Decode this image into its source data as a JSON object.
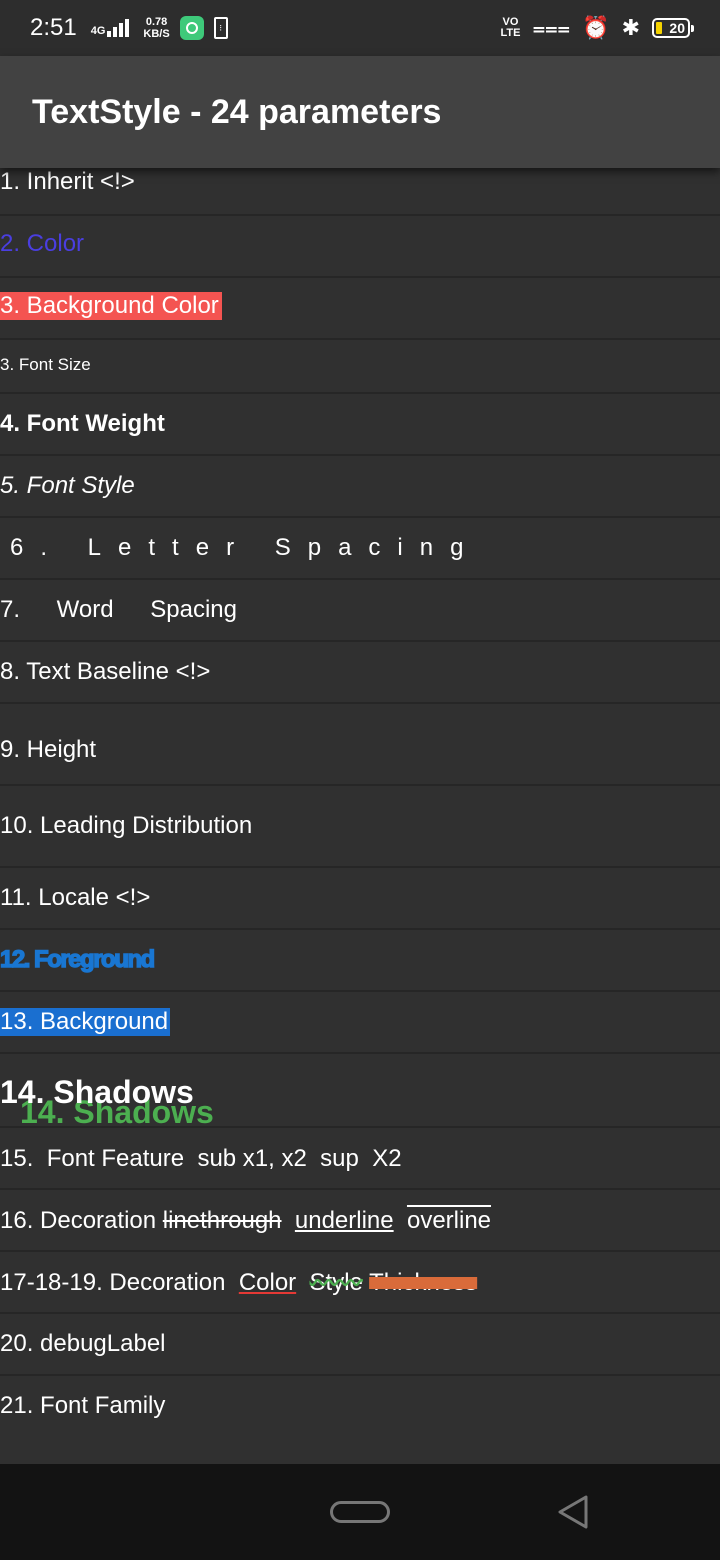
{
  "status_bar": {
    "time": "2:51",
    "network": "4G",
    "speed_value": "0.78",
    "speed_unit": "KB/S",
    "volte_top": "VO",
    "volte_bottom": "LTE",
    "battery": "20",
    "icons": [
      "app-badge-icon",
      "sim-icon",
      "vibrate-icon",
      "alarm-icon",
      "bluetooth-icon",
      "battery-icon"
    ]
  },
  "app_bar": {
    "title": "TextStyle - 24 parameters"
  },
  "items": [
    "1. Inherit <!>",
    "2. Color",
    "3. Background Color",
    "3. Font Size",
    "4. Font Weight",
    "5. Font Style",
    "6. Letter Spacing",
    "7. Word Spacing",
    "8. Text Baseline <!>",
    "9. Height",
    "10. Leading Distribution",
    "11. Locale <!>",
    "12. Foreground",
    "13. Background",
    "14. Shadows",
    "15.  Font Feature  sub x1, x2  sup  X2",
    "16. Decoration",
    "17-18-19. Decoration",
    "20. debugLabel",
    "21. Font Family"
  ],
  "decoration_16": {
    "linethrough": "linethrough",
    "underline": "underline",
    "overline": "overline"
  },
  "decoration_17": {
    "color": "Color",
    "style": "Style",
    "thickness": "Thickness"
  },
  "colors": {
    "background": "#303030",
    "app_bar": "#424242",
    "color_item": "#4a3ee0",
    "background_color_item": "#f45451",
    "foreground_item": "#1976d2",
    "background_item": "#1a6fd0",
    "shadow": "#4caf50",
    "decoration_color": "#e53935",
    "decoration_style": "#4caf50",
    "decoration_thickness": "#d96b3a"
  }
}
